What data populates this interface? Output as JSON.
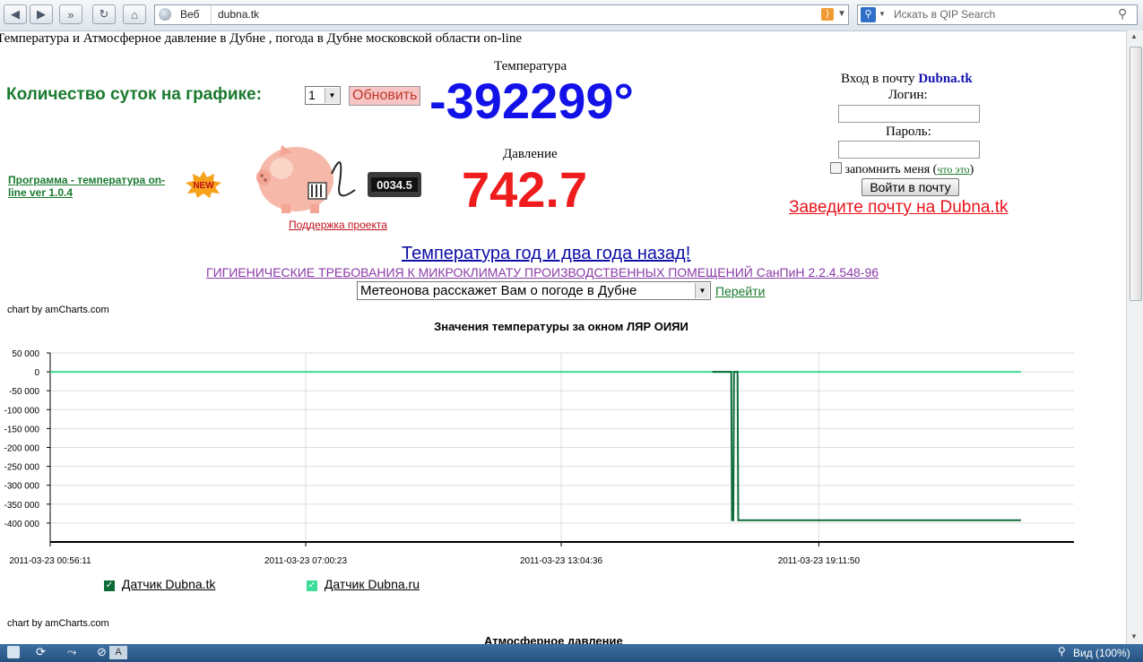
{
  "browser": {
    "address": "dubna.tk",
    "search_scope": "Веб",
    "search_placeholder": "Искать в QIP Search"
  },
  "page": {
    "title_line": "Температура и Атмосферное давление в Дубне , погода в Дубне московской области on-line",
    "days_label": "Количество суток на графике:",
    "days_value": "1",
    "refresh_button": "Обновить",
    "temperature_label": "Температура",
    "temperature_value": "-392299°",
    "pressure_label": "Давление",
    "pressure_value": "742.7",
    "program_link": "Программа - температура on-line ver 1.0.4",
    "new_badge": "NEW",
    "counter_display": "0034.5",
    "support_link": "Поддержка проекта",
    "login_title": "Вход в почту",
    "login_brand": "Dubna.tk",
    "login_label": "Логин:",
    "password_label": "Пароль:",
    "remember_label": "запомнить меня",
    "what_is_link": "что это",
    "login_button": "Войти в почту",
    "signup_link": "Заведите почту на Dubna.tk",
    "year_link": "Температура год и два года назад!",
    "sanpin_link": "ГИГИЕНИЧЕСКИЕ ТРЕБОВАНИЯ К МИКРОКЛИМАТУ ПРОИЗВОДСТВЕННЫХ ПОМЕЩЕНИЙ СанПиН 2.2.4.548-96",
    "meteo_select": "Метеонова расскажет Вам о погоде в Дубне",
    "go_link": "Перейти",
    "credit1": "chart by amCharts.com",
    "credit2": "chart by amCharts.com",
    "chart2_title": "Атмосферное давление"
  },
  "status": {
    "zoom": "Вид (100%)"
  },
  "chart_data": {
    "type": "line",
    "title": "Значения температуры за окном ЛЯР ОИЯИ",
    "ylim": [
      -450000,
      50000
    ],
    "yticks": [
      50000,
      0,
      -50000,
      -100000,
      -150000,
      -200000,
      -250000,
      -300000,
      -350000,
      -400000
    ],
    "ytick_labels": [
      "50 000",
      "0",
      "-50 000",
      "-100 000",
      "-150 000",
      "-200 000",
      "-250 000",
      "-300 000",
      "-350 000",
      "-400 000"
    ],
    "xtick_labels": [
      "2011-03-23 00:56:11",
      "2011-03-23 07:00:23",
      "2011-03-23 13:04:36",
      "2011-03-23 19:11:50"
    ],
    "grid": true,
    "legend_position": "bottom-left",
    "series": [
      {
        "name": "Датчик Dubna.tk",
        "color": "#0e6b3a",
        "points": [
          [
            "2011-03-23 16:40:00",
            0
          ],
          [
            "2011-03-23 17:07:00",
            0
          ],
          [
            "2011-03-23 17:08:00",
            -392299
          ],
          [
            "2011-03-23 17:10:00",
            -392299
          ],
          [
            "2011-03-23 17:11:00",
            0
          ],
          [
            "2011-03-23 17:16:00",
            0
          ],
          [
            "2011-03-23 17:17:00",
            -392299
          ],
          [
            "2011-03-23 23:59:59",
            -392299
          ]
        ]
      },
      {
        "name": "Датчик Dubna.ru",
        "color": "#3ddc97",
        "points": [
          [
            "2011-03-23 00:56:11",
            0
          ],
          [
            "2011-03-23 23:59:59",
            0
          ]
        ]
      }
    ]
  }
}
